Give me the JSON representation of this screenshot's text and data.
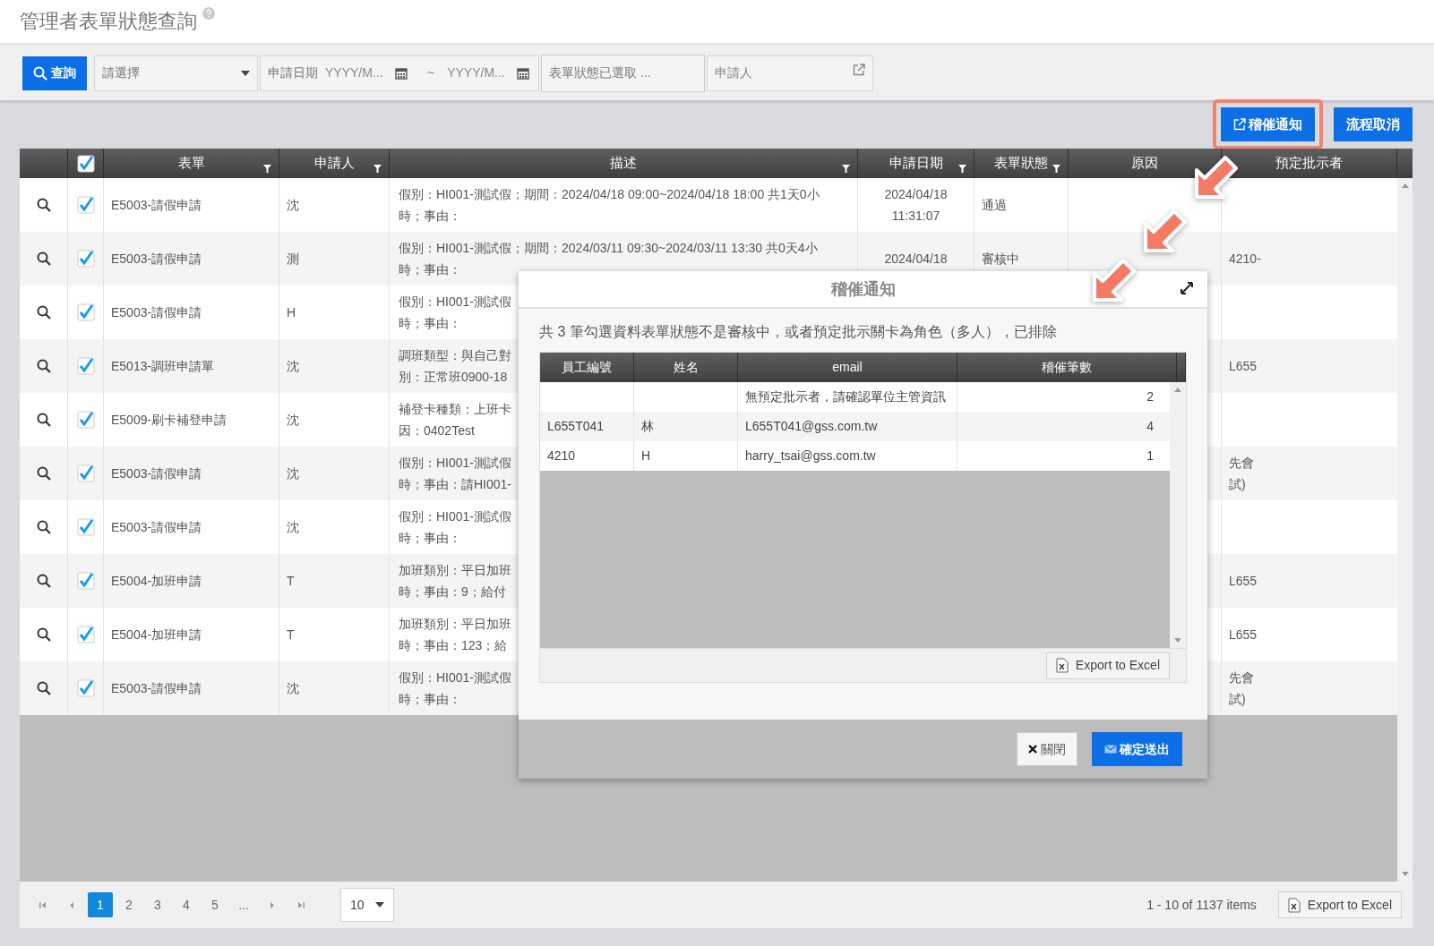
{
  "page": {
    "title": "管理者表單狀態查詢"
  },
  "toolbar": {
    "search_button": "查詢",
    "type_select": {
      "value": "請選擇"
    },
    "date_label": "申請日期",
    "date_from": {
      "placeholder": "YYYY/M..."
    },
    "date_separator": "~",
    "date_to": {
      "placeholder": "YYYY/M..."
    },
    "status_field": {
      "value": "表單狀態已選取 ..."
    },
    "applicant_field": {
      "placeholder": "申請人"
    }
  },
  "actions": [
    {
      "label": "稽催通知",
      "highlighted": true
    },
    {
      "label": "流程取消",
      "highlighted": false
    }
  ],
  "grid": {
    "all_checked": true,
    "columns": [
      {
        "label": "表單",
        "filter": true
      },
      {
        "label": "申請人",
        "filter": true
      },
      {
        "label": "描述",
        "filter": true
      },
      {
        "label": "申請日期",
        "filter": true
      },
      {
        "label": "表單狀態",
        "filter": true
      },
      {
        "label": "原因",
        "filter": false
      },
      {
        "label": "預定批示者",
        "filter": false
      }
    ],
    "rows": [
      {
        "checked": true,
        "form": "E5003-請假申請",
        "applicant": "沈",
        "description": [
          "假別：HI001-測試假；期間：2024/04/18 09:00~2024/04/18 18:00 共1天0小",
          "時；事由："
        ],
        "date": [
          "2024/04/18",
          "11:31:07"
        ],
        "status": "通過",
        "approver": []
      },
      {
        "checked": true,
        "form": "E5003-請假申請",
        "applicant": "測",
        "description": [
          "假別：HI001-測試假；期間：2024/03/11 09:30~2024/03/11 13:30 共0天4小",
          "時；事由："
        ],
        "date": [
          "2024/04/18"
        ],
        "status": "審核中",
        "approver": [
          "4210-"
        ]
      },
      {
        "checked": true,
        "form": "E5003-請假申請",
        "applicant": "H",
        "description": [
          "假別：HI001-測試假",
          "時；事由："
        ],
        "date": [],
        "approver": []
      },
      {
        "checked": true,
        "form": "E5013-調班申請單",
        "applicant": "沈",
        "description": [
          "調班類型：與自己對",
          "別：正常班0900-18"
        ],
        "date": [],
        "approver": [
          "L655"
        ]
      },
      {
        "checked": true,
        "form": "E5009-刷卡補登申請",
        "applicant": "沈",
        "description": [
          "補登卡種類：上班卡",
          "因：0402Test"
        ],
        "date": [],
        "approver": []
      },
      {
        "checked": true,
        "form": "E5003-請假申請",
        "applicant": "沈",
        "description": [
          "假別：HI001-測試假",
          "時；事由：請HI001-"
        ],
        "date": [],
        "approver": [
          "先會",
          "試)"
        ]
      },
      {
        "checked": true,
        "form": "E5003-請假申請",
        "applicant": "沈",
        "description": [
          "假別：HI001-測試假",
          "時；事由："
        ],
        "date": [],
        "approver": []
      },
      {
        "checked": true,
        "form": "E5004-加班申請",
        "applicant": "T",
        "description": [
          "加班類別：平日加班",
          "時；事由：9；給付"
        ],
        "date": [],
        "approver": [
          "L655"
        ]
      },
      {
        "checked": true,
        "form": "E5004-加班申請",
        "applicant": "T",
        "description": [
          "加班類別：平日加班",
          "時；事由：123；給"
        ],
        "date": [],
        "approver": [
          "L655"
        ]
      },
      {
        "checked": true,
        "form": "E5003-請假申請",
        "applicant": "沈",
        "description": [
          "假別：HI001-測試假",
          "時；事由："
        ],
        "date": [],
        "approver": [
          "先會",
          "試)"
        ]
      }
    ],
    "pager": {
      "pages": [
        {
          "label": "1",
          "selected": true
        },
        {
          "label": "2",
          "selected": false
        },
        {
          "label": "3",
          "selected": false
        },
        {
          "label": "4",
          "selected": false
        },
        {
          "label": "5",
          "selected": false
        },
        {
          "label": "...",
          "selected": false
        }
      ],
      "page_size": "10",
      "summary": "1 - 10 of 1137 items",
      "export": "Export to Excel"
    }
  },
  "dialog": {
    "title": "稽催通知",
    "message": "共 3 筆勾選資料表單狀態不是審核中，或者預定批示關卡為角色（多人），已排除",
    "columns": [
      "員工編號",
      "姓名",
      "email",
      "稽催筆數"
    ],
    "rows": [
      {
        "email": "無預定批示者，請確認單位主管資訊",
        "count": "2"
      },
      {
        "emp_id": "L655T041",
        "name": "林",
        "email": "L655T041@gss.com.tw",
        "count": "4"
      },
      {
        "emp_id": "4210",
        "name": "H",
        "email": "harry_tsai@gss.com.tw",
        "count": "1"
      }
    ],
    "export": "Export to Excel",
    "buttons": [
      {
        "kind": "close",
        "label": "關閉"
      },
      {
        "kind": "submit",
        "label": "確定送出"
      }
    ]
  }
}
